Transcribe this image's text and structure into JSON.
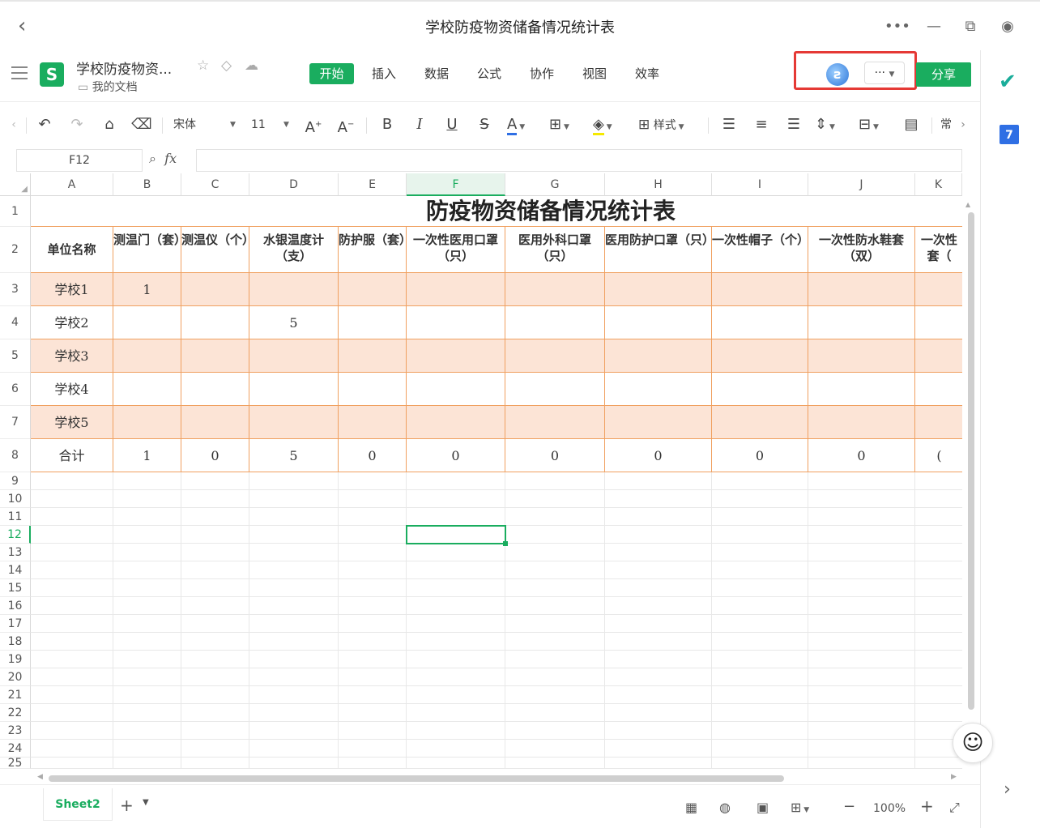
{
  "window": {
    "title": "学校防疫物资储备情况统计表"
  },
  "doc": {
    "name": "学校防疫物资...",
    "folder": "我的文档",
    "app_logo": "S",
    "tabs": [
      "开始",
      "插入",
      "数据",
      "公式",
      "协作",
      "视图",
      "效率"
    ],
    "active_tab": "开始",
    "more_label": "···",
    "share_label": "分享"
  },
  "toolbar": {
    "font_name": "宋体",
    "font_size": "11",
    "style_label": "样式",
    "overflow_label": "常"
  },
  "formula": {
    "cell_ref": "F12",
    "fx_label": "fx",
    "value": ""
  },
  "grid": {
    "columns": [
      "A",
      "B",
      "C",
      "D",
      "E",
      "F",
      "G",
      "H",
      "I",
      "J",
      "K"
    ],
    "rows": [
      "1",
      "2",
      "3",
      "4",
      "5",
      "6",
      "7",
      "8",
      "9",
      "10",
      "11",
      "12",
      "13",
      "14",
      "15",
      "16",
      "17",
      "18",
      "19",
      "20",
      "21",
      "22",
      "23",
      "24",
      "25"
    ],
    "selected_column": "F",
    "selected_row": "12"
  },
  "sheet": {
    "title": "防疫物资储备情况统计表",
    "headers": [
      "单位名称",
      "测温门（套）",
      "测温仪（个）",
      "水银温度计（支）",
      "防护服（套）",
      "一次性医用口罩（只）",
      "医用外科口罩（只）",
      "医用防护口罩（只）",
      "一次性帽子（个）",
      "一次性防水鞋套（双）",
      "一次性套（"
    ],
    "rows": [
      [
        "学校1",
        "1",
        "",
        "",
        "",
        "",
        "",
        "",
        "",
        "",
        ""
      ],
      [
        "学校2",
        "",
        "",
        "5",
        "",
        "",
        "",
        "",
        "",
        "",
        ""
      ],
      [
        "学校3",
        "",
        "",
        "",
        "",
        "",
        "",
        "",
        "",
        "",
        ""
      ],
      [
        "学校4",
        "",
        "",
        "",
        "",
        "",
        "",
        "",
        "",
        "",
        ""
      ],
      [
        "学校5",
        "",
        "",
        "",
        "",
        "",
        "",
        "",
        "",
        "",
        ""
      ],
      [
        "合计",
        "1",
        "0",
        "5",
        "0",
        "0",
        "0",
        "0",
        "0",
        "0",
        "("
      ]
    ]
  },
  "status": {
    "sheet_tab": "Sheet2",
    "add_label": "+",
    "zoom": "100%",
    "zoom_out": "−",
    "zoom_in": "+"
  },
  "colors": {
    "accent": "#1aad5f",
    "highlight_row": "#fce4d6",
    "table_border": "#f0a060",
    "annotation_red": "#e53935"
  }
}
